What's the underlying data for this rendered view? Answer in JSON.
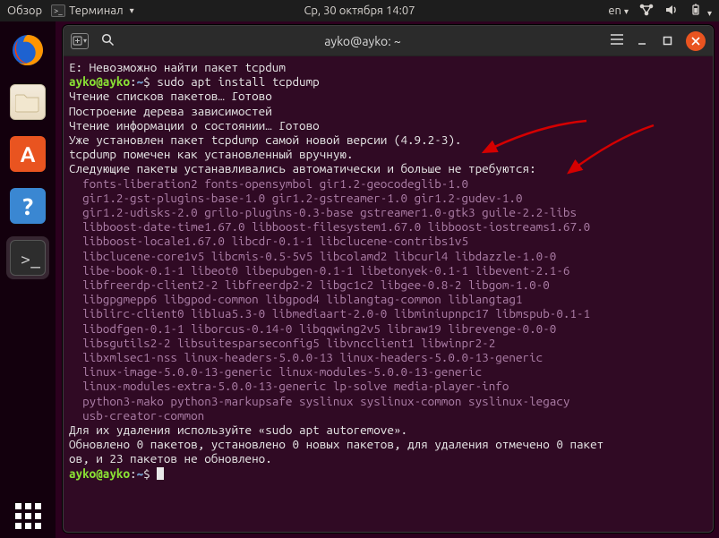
{
  "panel": {
    "activities": "Обзор",
    "app_menu": "Терминал",
    "clock": "Ср, 30 октября  14:07",
    "lang": "en"
  },
  "dock": {
    "items": [
      {
        "name": "firefox"
      },
      {
        "name": "files"
      },
      {
        "name": "software"
      },
      {
        "name": "help"
      },
      {
        "name": "terminal"
      }
    ]
  },
  "window": {
    "title": "ayko@ayko: ~"
  },
  "prompt": {
    "userhost": "ayko@ayko",
    "path": "~",
    "sep": ":",
    "end": "$"
  },
  "out": {
    "err": "E: Невозможно найти пакет tcpdum",
    "cmd1": "sudo apt install tcpdump",
    "l1": "Чтение списков пакетов… Готово",
    "l2": "Построение дерева зависимостей",
    "l3": "Чтение информации о состоянии… Готово",
    "l4": "Уже установлен пакет tcpdump самой новой версии (4.9.2-3).",
    "l5": "tcpdump помечен как установленный вручную.",
    "l6": "Следующие пакеты устанавливались автоматически и больше не требуются:",
    "p1": "  fonts-liberation2 fonts-opensymbol gir1.2-geocodeglib-1.0",
    "p2": "  gir1.2-gst-plugins-base-1.0 gir1.2-gstreamer-1.0 gir1.2-gudev-1.0",
    "p3": "  gir1.2-udisks-2.0 grilo-plugins-0.3-base gstreamer1.0-gtk3 guile-2.2-libs",
    "p4": "  libboost-date-time1.67.0 libboost-filesystem1.67.0 libboost-iostreams1.67.0",
    "p5": "  libboost-locale1.67.0 libcdr-0.1-1 libclucene-contribs1v5",
    "p6": "  libclucene-core1v5 libcmis-0.5-5v5 libcolamd2 libcurl4 libdazzle-1.0-0",
    "p7": "  libe-book-0.1-1 libeot0 libepubgen-0.1-1 libetonyek-0.1-1 libevent-2.1-6",
    "p8": "  libfreerdp-client2-2 libfreerdp2-2 libgc1c2 libgee-0.8-2 libgom-1.0-0",
    "p9": "  libgpgmepp6 libgpod-common libgpod4 liblangtag-common liblangtag1",
    "p10": "  liblirc-client0 liblua5.3-0 libmediaart-2.0-0 libminiupnpc17 libmspub-0.1-1",
    "p11": "  libodfgen-0.1-1 liborcus-0.14-0 libqqwing2v5 libraw19 librevenge-0.0-0",
    "p12": "  libsgutils2-2 libsuitesparseconfig5 libvncclient1 libwinpr2-2",
    "p13": "  libxmlsec1-nss linux-headers-5.0.0-13 linux-headers-5.0.0-13-generic",
    "p14": "  linux-image-5.0.0-13-generic linux-modules-5.0.0-13-generic",
    "p15": "  linux-modules-extra-5.0.0-13-generic lp-solve media-player-info",
    "p16": "  python3-mako python3-markupsafe syslinux syslinux-common syslinux-legacy",
    "p17": "  usb-creator-common",
    "l7": "Для их удаления используйте «sudo apt autoremove».",
    "l8": "Обновлено 0 пакетов, установлено 0 новых пакетов, для удаления отмечено 0 пакет",
    "l9": "ов, и 23 пакетов не обновлено."
  }
}
